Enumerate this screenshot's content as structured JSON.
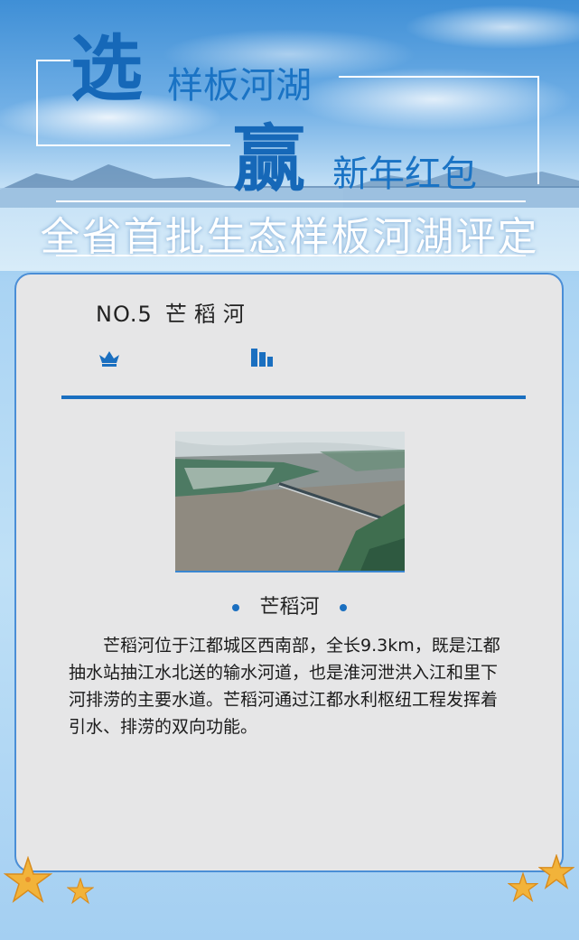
{
  "header": {
    "char_choose": "选",
    "text_model_rivers": "样板河湖",
    "char_win": "赢",
    "text_red_envelope": "新年红包",
    "headline": "全省首批生态样板河湖评定"
  },
  "card": {
    "number": "NO.5",
    "river_name": "芒稻河",
    "icons": [
      "crown-icon",
      "bar-chart-icon"
    ],
    "photo_caption": "芒稻河",
    "description": "芒稻河位于江都城区西南部，全长9.3km，既是江都抽水站抽江水北送的输水河道，也是淮河泄洪入江和里下河排涝的主要水道。芒稻河通过江都水利枢纽工程发挥着引水、排涝的双向功能。"
  },
  "colors": {
    "accent_blue": "#1a6fc0",
    "card_bg": "#e6e6e7",
    "title_blue": "#1668b8"
  }
}
